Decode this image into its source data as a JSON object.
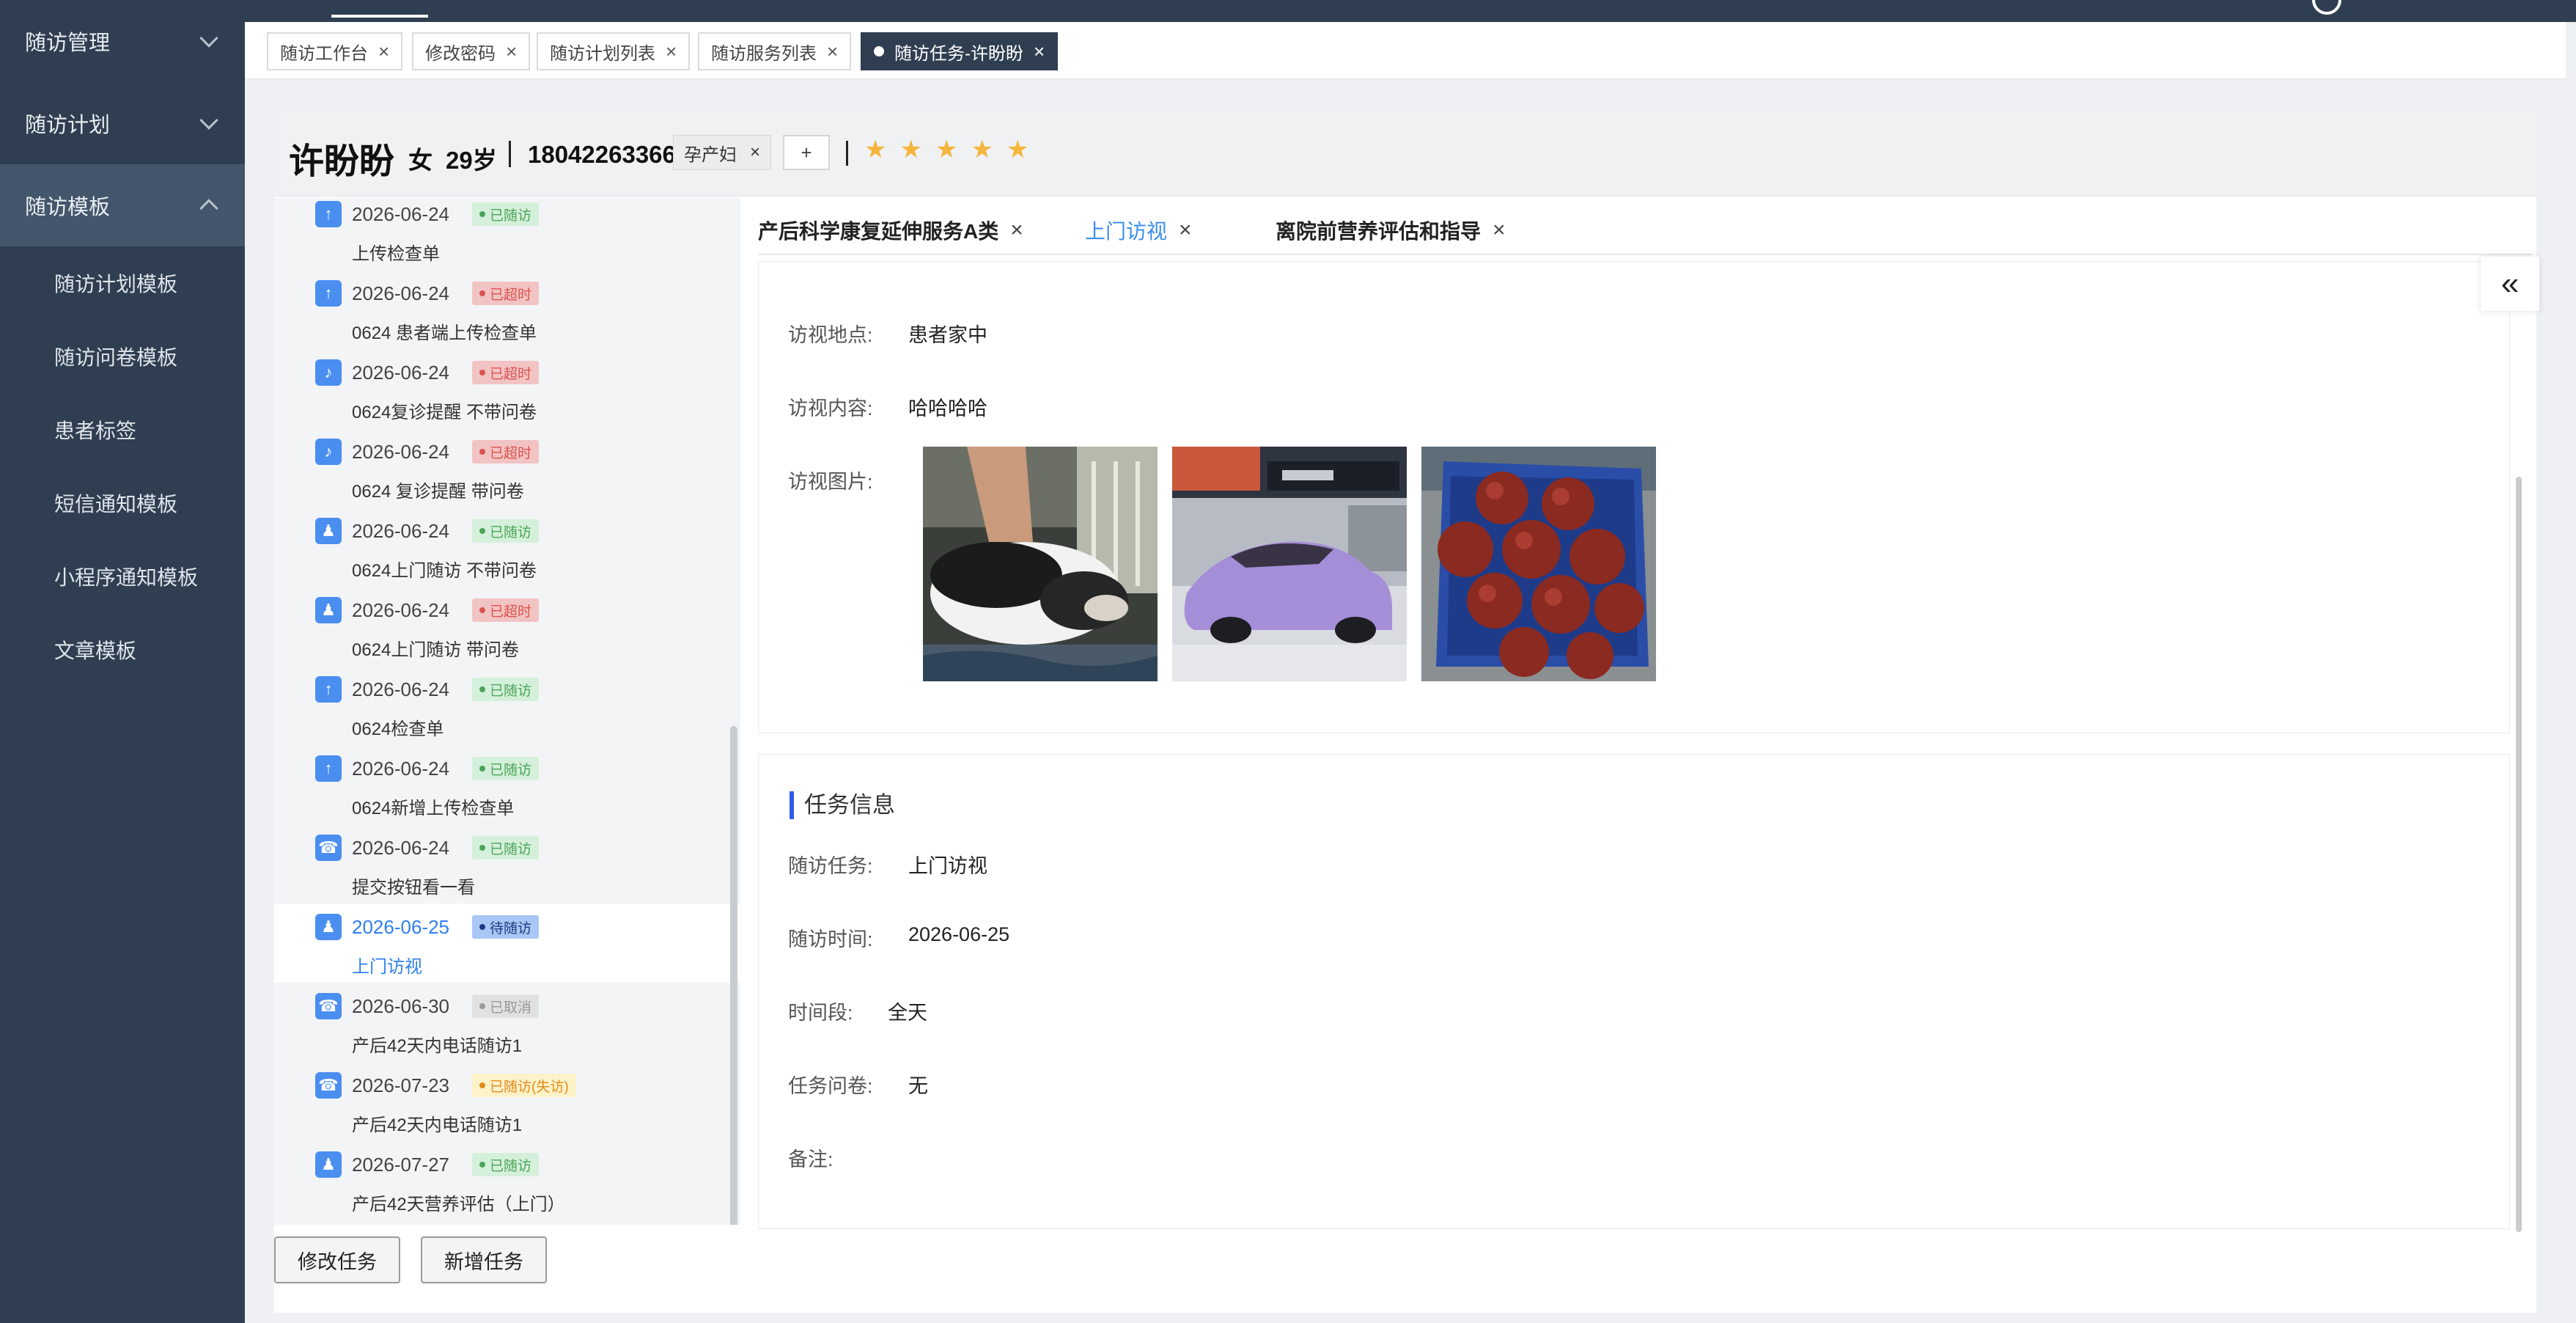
{
  "sidebar": {
    "groups": [
      {
        "label": "随访管理",
        "expanded": false
      },
      {
        "label": "随访计划",
        "expanded": false
      },
      {
        "label": "随访模板",
        "expanded": true
      }
    ],
    "sub_items": [
      "随访计划模板",
      "随访问卷模板",
      "患者标签",
      "短信通知模板",
      "小程序通知模板",
      "文章模板"
    ]
  },
  "page_tabs": [
    {
      "label": "随访工作台"
    },
    {
      "label": "修改密码"
    },
    {
      "label": "随访计划列表"
    },
    {
      "label": "随访服务列表"
    },
    {
      "label": "随访任务-许盼盼",
      "active": true
    }
  ],
  "patient": {
    "name": "许盼盼",
    "gender": "女",
    "age": "29岁",
    "phone": "18042263366",
    "tag": "孕产妇",
    "add_tag": "+",
    "stars": [
      "★",
      "★",
      "★",
      "★",
      "★"
    ]
  },
  "timeline": [
    {
      "date": "2026-06-24",
      "status": "已随访",
      "name": "上传检查单",
      "icon": "upload-icon",
      "kind": "green"
    },
    {
      "date": "2026-06-24",
      "status": "已超时",
      "name": "0624 患者端上传检查单",
      "icon": "upload-icon",
      "kind": "red"
    },
    {
      "date": "2026-06-24",
      "status": "已超时",
      "name": "0624复诊提醒 不带问卷",
      "icon": "bell-icon",
      "kind": "red"
    },
    {
      "date": "2026-06-24",
      "status": "已超时",
      "name": "0624 复诊提醒 带问卷",
      "icon": "bell-icon",
      "kind": "red"
    },
    {
      "date": "2026-06-24",
      "status": "已随访",
      "name": "0624上门随访 不带问卷",
      "icon": "person-icon",
      "kind": "green"
    },
    {
      "date": "2026-06-24",
      "status": "已超时",
      "name": "0624上门随访 带问卷",
      "icon": "person-icon",
      "kind": "red"
    },
    {
      "date": "2026-06-24",
      "status": "已随访",
      "name": "0624检查单",
      "icon": "upload-icon",
      "kind": "green"
    },
    {
      "date": "2026-06-24",
      "status": "已随访",
      "name": "0624新增上传检查单",
      "icon": "upload-icon",
      "kind": "green"
    },
    {
      "date": "2026-06-24",
      "status": "已随访",
      "name": "提交按钮看一看",
      "icon": "phone-icon",
      "kind": "green"
    },
    {
      "date": "2026-06-25",
      "status": "待随访",
      "name": "上门访视",
      "icon": "person-icon",
      "kind": "blue",
      "selected": true
    },
    {
      "date": "2026-06-30",
      "status": "已取消",
      "name": "产后42天内电话随访1",
      "icon": "phone-icon",
      "kind": "gray"
    },
    {
      "date": "2026-07-23",
      "status": "已随访(失访)",
      "name": "产后42天内电话随访1",
      "icon": "phone-icon",
      "kind": "yellow"
    },
    {
      "date": "2026-07-27",
      "status": "已随访",
      "name": "产后42天营养评估（上门）",
      "icon": "person-icon",
      "kind": "green"
    }
  ],
  "buttons": {
    "edit": "修改任务",
    "add": "新增任务"
  },
  "sub_tabs": [
    {
      "label": "产后科学康复延伸服务A类"
    },
    {
      "label": "上门访视",
      "active": true
    },
    {
      "label": "离院前营养评估和指导"
    }
  ],
  "visit": {
    "location_label": "访视地点:",
    "location": "患者家中",
    "content_label": "访视内容:",
    "content": "哈哈哈哈",
    "images_label": "访视图片:"
  },
  "task": {
    "section_title": "任务信息",
    "task_label": "随访任务:",
    "task": "上门访视",
    "time_label": "随访时间:",
    "time": "2026-06-25",
    "period_label": "时间段:",
    "period": "全天",
    "survey_label": "任务问卷:",
    "survey": "无",
    "note_label": "备注:"
  },
  "icons": {
    "close": "×",
    "collapse": "«"
  },
  "colors": {
    "sidebar": "#2f3e50",
    "accent": "#3c8df0",
    "star": "#f4b63c"
  }
}
